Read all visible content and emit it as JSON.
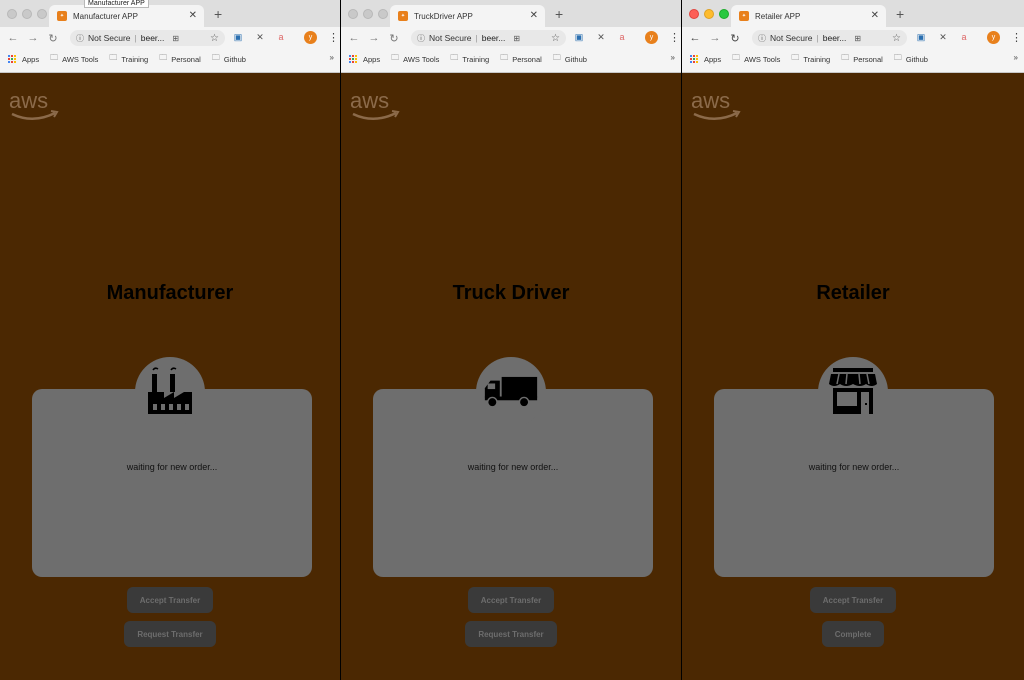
{
  "windows": [
    {
      "tab_title": "Manufacturer APP",
      "tooltip": "Manufacturer APP",
      "role_title": "Manufacturer",
      "icon": "factory-icon",
      "status": "waiting for new order...",
      "button1": "Accept Transfer",
      "button2": "Request Transfer"
    },
    {
      "tab_title": "TruckDriver APP",
      "role_title": "Truck Driver",
      "icon": "truck-icon",
      "status": "waiting for new order...",
      "button1": "Accept Transfer",
      "button2": "Request Transfer"
    },
    {
      "tab_title": "Retailer APP",
      "role_title": "Retailer",
      "icon": "store-icon",
      "status": "waiting for new order...",
      "button1": "Accept Transfer",
      "button2": "Complete"
    }
  ],
  "browser": {
    "security_label": "Not Secure",
    "url": "beer...",
    "avatar_letter": "y",
    "bookmarks": [
      "Apps",
      "AWS Tools",
      "Training",
      "Personal",
      "Github"
    ],
    "more": "»",
    "logo_text": "aws"
  },
  "colors": {
    "page_background": "#4b2802",
    "card": "#6e6e6e",
    "button": "#3a3a3a",
    "favicon": "#e8801c"
  }
}
